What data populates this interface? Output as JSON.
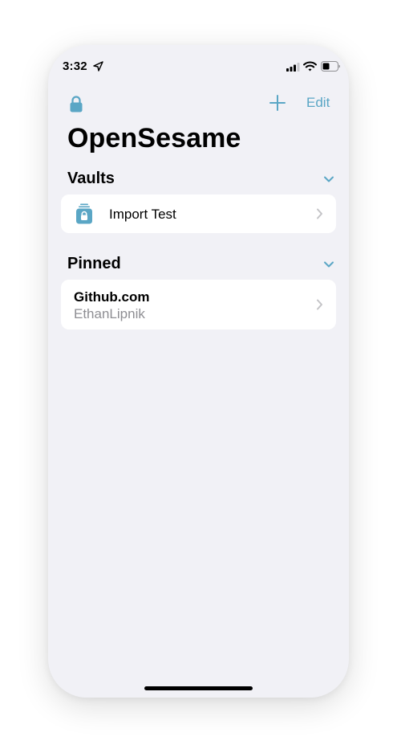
{
  "status_bar": {
    "time": "3:32",
    "icons": [
      "location-arrow-icon",
      "cellular-signal-icon",
      "wifi-icon",
      "battery-icon"
    ]
  },
  "nav": {
    "lock_icon": "lock-icon",
    "add_icon": "plus-icon",
    "edit_label": "Edit"
  },
  "title": "OpenSesame",
  "sections": {
    "vaults": {
      "title": "Vaults",
      "items": [
        {
          "label": "Import Test",
          "icon": "vault-lock-icon"
        }
      ]
    },
    "pinned": {
      "title": "Pinned",
      "items": [
        {
          "title": "Github.com",
          "subtitle": "EthanLipnik"
        }
      ]
    }
  },
  "colors": {
    "accent": "#5aa6c5",
    "background": "#f1f1f6",
    "card": "#ffffff",
    "secondary_text": "#8e8e93",
    "chevron": "#c4c4c7"
  }
}
